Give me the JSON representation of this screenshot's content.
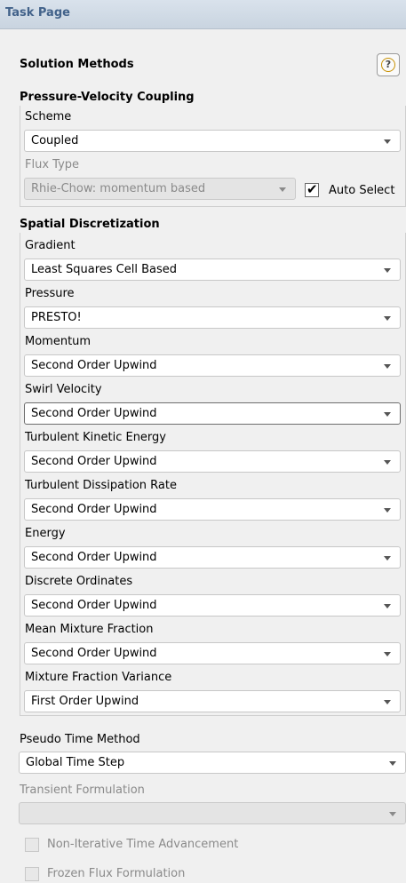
{
  "panel": {
    "title": "Task Page"
  },
  "header": {
    "title": "Solution Methods",
    "help_glyph": "?"
  },
  "pvc": {
    "title": "Pressure-Velocity Coupling",
    "scheme": {
      "label": "Scheme",
      "value": "Coupled"
    },
    "flux_type": {
      "label": "Flux Type",
      "value": "Rhie-Chow: momentum based"
    },
    "auto_select": {
      "label": "Auto Select",
      "checked": true
    }
  },
  "spatial": {
    "title": "Spatial Discretization",
    "fields": [
      {
        "label": "Gradient",
        "value": "Least Squares Cell Based"
      },
      {
        "label": "Pressure",
        "value": "PRESTO!"
      },
      {
        "label": "Momentum",
        "value": "Second Order Upwind"
      },
      {
        "label": "Swirl Velocity",
        "value": "Second Order Upwind"
      },
      {
        "label": "Turbulent Kinetic Energy",
        "value": "Second Order Upwind"
      },
      {
        "label": "Turbulent Dissipation Rate",
        "value": "Second Order Upwind"
      },
      {
        "label": "Energy",
        "value": "Second Order Upwind"
      },
      {
        "label": "Discrete Ordinates",
        "value": "Second Order Upwind"
      },
      {
        "label": "Mean Mixture Fraction",
        "value": "Second Order Upwind"
      },
      {
        "label": "Mixture Fraction Variance",
        "value": "First Order Upwind"
      }
    ]
  },
  "pseudo_time": {
    "label": "Pseudo Time Method",
    "value": "Global Time Step"
  },
  "transient": {
    "label": "Transient Formulation",
    "value": ""
  },
  "options": {
    "non_iterative": {
      "label": "Non-Iterative Time Advancement",
      "checked": false
    },
    "frozen_flux": {
      "label": "Frozen Flux Formulation",
      "checked": false
    }
  },
  "icons": {
    "help": "help-icon",
    "dropdown": "chevron-down-icon",
    "checkbox": "checkmark-icon"
  },
  "colors": {
    "title_bar": "#c9d4e0",
    "title_text": "#42628a",
    "help_accent": "#c89000"
  }
}
